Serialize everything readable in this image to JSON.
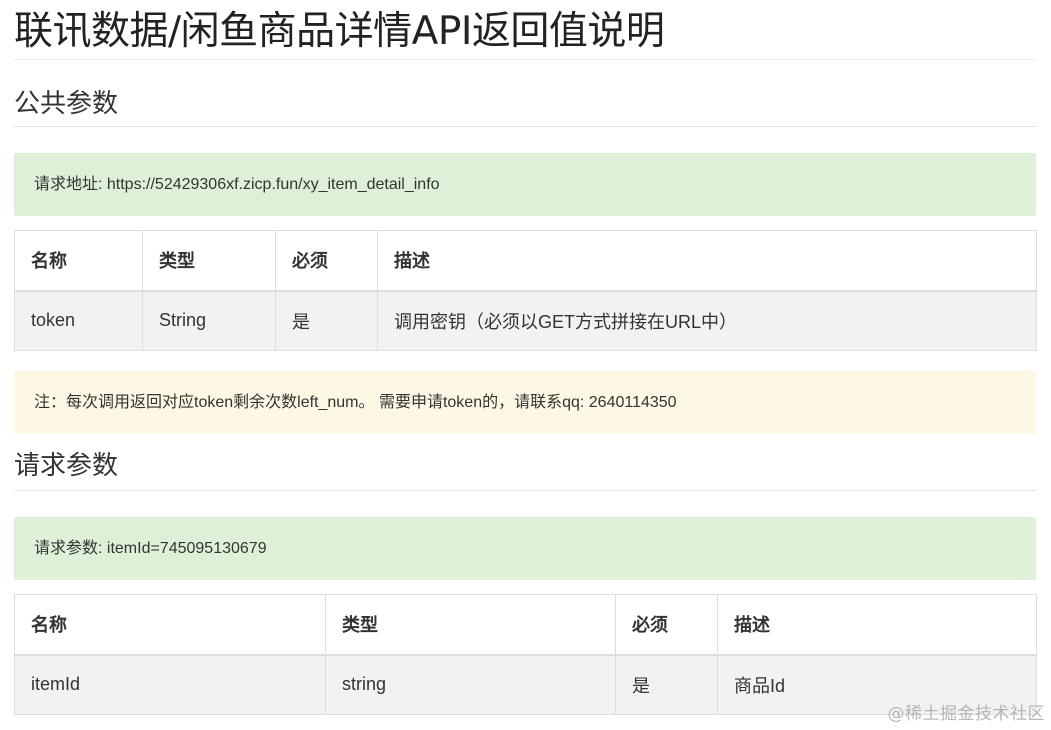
{
  "title": "联讯数据/闲鱼商品详情API返回值说明",
  "public_params": {
    "heading": "公共参数",
    "endpoint_label": "请求地址: https://52429306xf.zicp.fun/xy_item_detail_info",
    "table": {
      "headers": [
        "名称",
        "类型",
        "必须",
        "描述"
      ],
      "rows": [
        [
          "token",
          "String",
          "是",
          "调用密钥（必须以GET方式拼接在URL中）"
        ]
      ]
    },
    "note": "注：每次调用返回对应token剩余次数left_num。 需要申请token的，请联系qq: 2640114350"
  },
  "request_params": {
    "heading": "请求参数",
    "example_label": "请求参数: itemId=745095130679",
    "table": {
      "headers": [
        "名称",
        "类型",
        "必须",
        "描述"
      ],
      "rows": [
        [
          "itemId",
          "string",
          "是",
          "商品Id"
        ]
      ]
    }
  },
  "watermark": "@稀土掘金技术社区",
  "colors": {
    "success_bg": "#dff0d8",
    "warning_bg": "#fcf8e3",
    "row_bg": "#f2f2f2",
    "border": "#dddddd"
  }
}
